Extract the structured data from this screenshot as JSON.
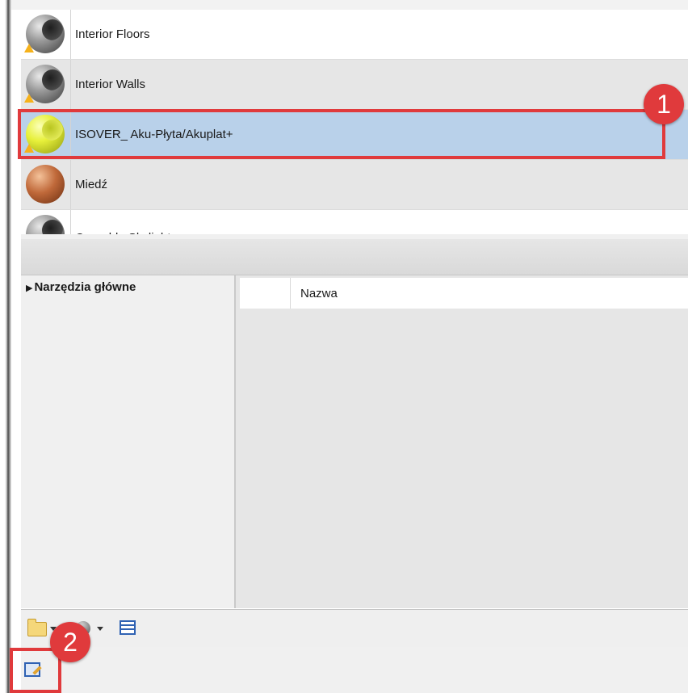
{
  "materials": {
    "items": [
      {
        "label": "Interior Floors",
        "thumbnail": "gray-sphere-icon",
        "warning": true
      },
      {
        "label": "Interior Walls",
        "thumbnail": "gray-sphere-icon",
        "warning": true
      },
      {
        "label": "ISOVER_ Aku-Płyta/Akuplat+",
        "thumbnail": "yellow-sphere-icon",
        "warning": true,
        "selected": true
      },
      {
        "label": "Miedź",
        "thumbnail": "copper-sphere-icon",
        "warning": false
      },
      {
        "label": "Operable Skylights",
        "thumbnail": "gray-sphere-icon",
        "warning": true
      }
    ],
    "selected_color": "#b9d1ea"
  },
  "annotations": {
    "badge_1": "1",
    "badge_2": "2",
    "color": "#e03a3c"
  },
  "tree": {
    "header": "Narzędzia główne"
  },
  "details": {
    "column_name": "Nazwa"
  },
  "toolbar": {
    "icons": [
      "folder-key-icon",
      "material-sphere-icon",
      "list-view-icon"
    ]
  },
  "status": {
    "icons": [
      "material-editor-icon"
    ]
  }
}
